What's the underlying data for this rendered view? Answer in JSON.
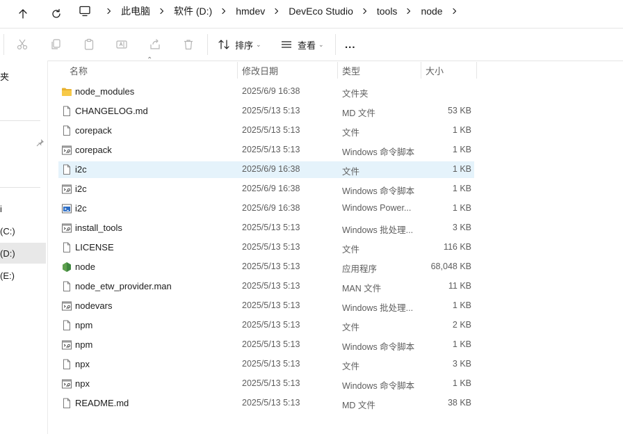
{
  "breadcrumbs": [
    "此电脑",
    "软件 (D:)",
    "hmdev",
    "DevEco Studio",
    "tools",
    "node"
  ],
  "toolbar": {
    "sort_label": "排序",
    "view_label": "查看",
    "more_label": "..."
  },
  "sidebar": {
    "items": [
      {
        "label": "夹"
      },
      {
        "label": "i"
      },
      {
        "label": "(C:)"
      },
      {
        "label": "(D:)",
        "selected": true
      },
      {
        "label": "(E:)"
      }
    ]
  },
  "columns": {
    "name": "名称",
    "date": "修改日期",
    "type": "类型",
    "size": "大小"
  },
  "files": [
    {
      "name": "node_modules",
      "date": "2025/6/9 16:38",
      "type": "文件夹",
      "size": "",
      "icon": "folder-icon"
    },
    {
      "name": "CHANGELOG.md",
      "date": "2025/5/13 5:13",
      "type": "MD 文件",
      "size": "53 KB",
      "icon": "file-icon"
    },
    {
      "name": "corepack",
      "date": "2025/5/13 5:13",
      "type": "文件",
      "size": "1 KB",
      "icon": "file-icon"
    },
    {
      "name": "corepack",
      "date": "2025/5/13 5:13",
      "type": "Windows 命令脚本",
      "size": "1 KB",
      "icon": "script-icon"
    },
    {
      "name": "i2c",
      "date": "2025/6/9 16:38",
      "type": "文件",
      "size": "1 KB",
      "icon": "file-icon",
      "selected": true
    },
    {
      "name": "i2c",
      "date": "2025/6/9 16:38",
      "type": "Windows 命令脚本",
      "size": "1 KB",
      "icon": "script-icon"
    },
    {
      "name": "i2c",
      "date": "2025/6/9 16:38",
      "type": "Windows Power...",
      "size": "1 KB",
      "icon": "powershell-icon"
    },
    {
      "name": "install_tools",
      "date": "2025/5/13 5:13",
      "type": "Windows 批处理...",
      "size": "3 KB",
      "icon": "script-icon"
    },
    {
      "name": "LICENSE",
      "date": "2025/5/13 5:13",
      "type": "文件",
      "size": "116 KB",
      "icon": "file-icon"
    },
    {
      "name": "node",
      "date": "2025/5/13 5:13",
      "type": "应用程序",
      "size": "68,048 KB",
      "icon": "node-app-icon"
    },
    {
      "name": "node_etw_provider.man",
      "date": "2025/5/13 5:13",
      "type": "MAN 文件",
      "size": "11 KB",
      "icon": "file-icon"
    },
    {
      "name": "nodevars",
      "date": "2025/5/13 5:13",
      "type": "Windows 批处理...",
      "size": "1 KB",
      "icon": "script-icon"
    },
    {
      "name": "npm",
      "date": "2025/5/13 5:13",
      "type": "文件",
      "size": "2 KB",
      "icon": "file-icon"
    },
    {
      "name": "npm",
      "date": "2025/5/13 5:13",
      "type": "Windows 命令脚本",
      "size": "1 KB",
      "icon": "script-icon"
    },
    {
      "name": "npx",
      "date": "2025/5/13 5:13",
      "type": "文件",
      "size": "3 KB",
      "icon": "file-icon"
    },
    {
      "name": "npx",
      "date": "2025/5/13 5:13",
      "type": "Windows 命令脚本",
      "size": "1 KB",
      "icon": "script-icon"
    },
    {
      "name": "README.md",
      "date": "2025/5/13 5:13",
      "type": "MD 文件",
      "size": "38 KB",
      "icon": "file-icon"
    }
  ],
  "colors": {
    "selection": "#e5f3fb",
    "folder": "#f7c948",
    "node_green": "#5fa04e"
  }
}
